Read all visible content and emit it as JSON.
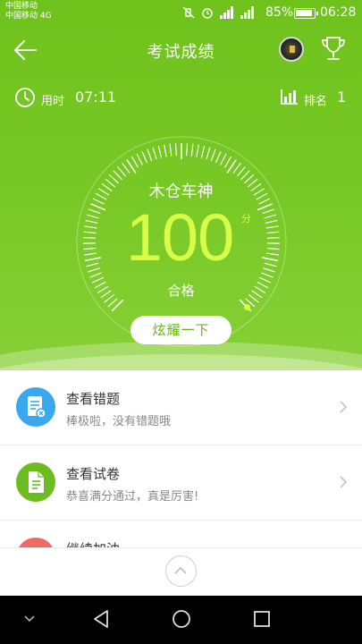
{
  "status_bar": {
    "carrier_1": "中国移动",
    "carrier_2": "中国移动 4G",
    "battery": "85%",
    "time": "06:28"
  },
  "header": {
    "title": "考试成绩"
  },
  "info": {
    "time_label": "用时",
    "time_value": "07:11",
    "rank_label": "排名",
    "rank_value": "1"
  },
  "result": {
    "user_name": "木仓车神",
    "score": "100",
    "score_unit": "分",
    "score_fraction": 1.0,
    "grade": "合格",
    "show_button": "炫耀一下"
  },
  "list": {
    "items": [
      {
        "title": "查看错题",
        "subtitle": "棒极啦，没有错题哦",
        "icon": "wrong-questions-icon",
        "color": "#3aa7ef"
      },
      {
        "title": "查看试卷",
        "subtitle": "恭喜满分通过，真是厉害!",
        "icon": "exam-paper-icon",
        "color": "#6cbb1f"
      }
    ],
    "partial_title": "继续加油"
  },
  "colors": {
    "accent": "#76c623",
    "score": "#d8ff48"
  }
}
